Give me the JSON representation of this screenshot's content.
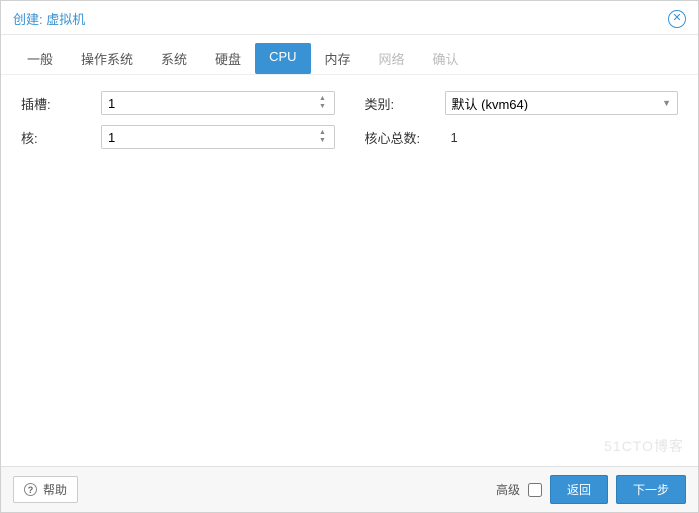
{
  "header": {
    "title": "创建: 虚拟机"
  },
  "tabs": {
    "general": "一般",
    "os": "操作系统",
    "system": "系统",
    "disk": "硬盘",
    "cpu": "CPU",
    "memory": "内存",
    "network": "网络",
    "confirm": "确认"
  },
  "form": {
    "sockets_label": "插槽:",
    "sockets_value": "1",
    "cores_label": "核:",
    "cores_value": "1",
    "type_label": "类别:",
    "type_value": "默认 (kvm64)",
    "total_label": "核心总数:",
    "total_value": "1"
  },
  "watermark": "51CTO博客",
  "footer": {
    "help": "帮助",
    "advanced": "高级",
    "back": "返回",
    "next": "下一步"
  }
}
